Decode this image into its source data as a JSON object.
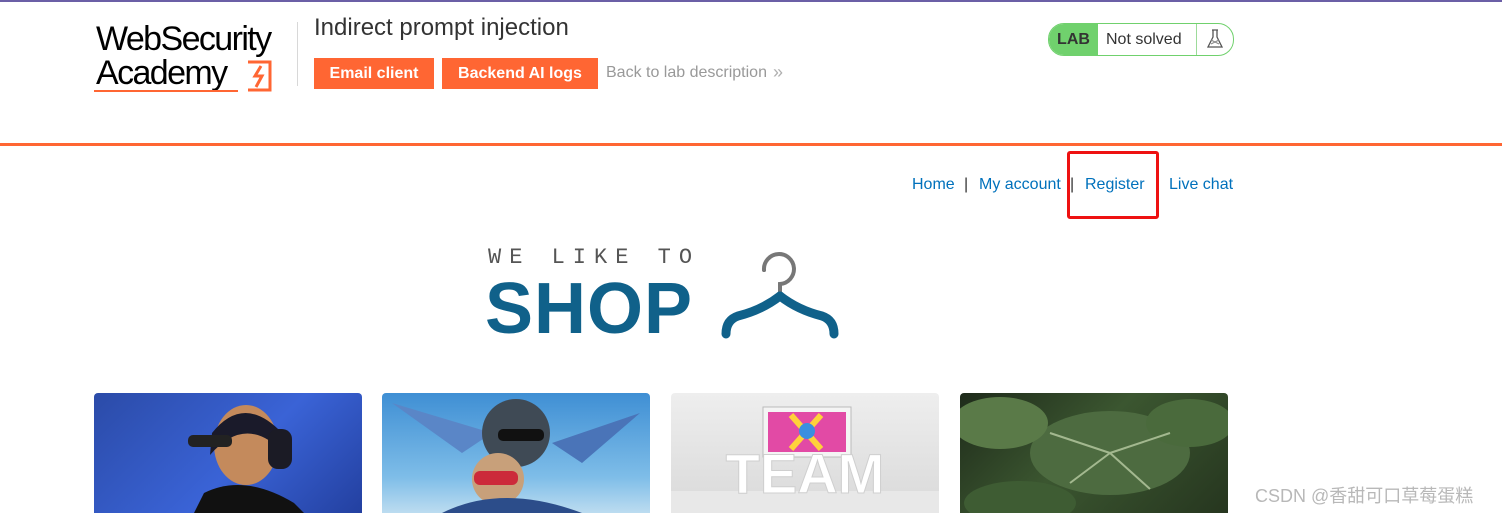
{
  "header": {
    "logo_line1": "WebSecurity",
    "logo_line2": "Academy",
    "lab_title": "Indirect prompt injection",
    "email_client_label": "Email client",
    "backend_logs_label": "Backend AI logs",
    "back_link_label": "Back to lab description",
    "back_chevron": "»"
  },
  "lab_status": {
    "badge": "LAB",
    "status": "Not solved"
  },
  "nav": {
    "home": "Home",
    "my_account": "My account",
    "register": "Register",
    "live_chat": "Live chat",
    "separator": "|"
  },
  "banner": {
    "tagline": "WE LIKE TO",
    "headline": "SHOP"
  },
  "products": [
    {
      "image": "woman-with-headphones"
    },
    {
      "image": "skydivers"
    },
    {
      "image": "team-letters"
    },
    {
      "image": "tropical-leaves"
    }
  ],
  "watermark": "CSDN @香甜可口草莓蛋糕",
  "colors": {
    "accent": "#ff6633",
    "link": "#0071bc",
    "lab_green": "#70d16d",
    "shop_blue": "#10618a",
    "highlight": "#ee1111"
  }
}
